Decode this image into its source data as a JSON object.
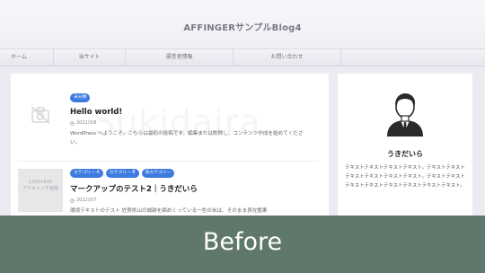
{
  "header": {
    "site_title": "AFFINGERサンプルBlog4"
  },
  "nav": {
    "items": [
      "ホーム",
      "当サイト",
      "運営者情報",
      "お問い合わせ"
    ]
  },
  "watermark": "Sukidaira",
  "posts": [
    {
      "categories": [
        "未分類"
      ],
      "title": "Hello world!",
      "date": "2022/3/8",
      "excerpt": "WordPress へようこそ。こちらは最初の投稿です。編集または削除し、コンテンツ作成を始めてください。",
      "thumbnail": "no-image"
    },
    {
      "categories": [
        "カテゴリー A",
        "カテゴリー B",
        "孫カテゴリー"
      ],
      "title": "マークアップのテスト2｜うきだいら",
      "date": "2022/3/7",
      "excerpt": "環境テキストのテスト 佐賀県山の城跡を締めくっている一色の米は、そのまま表在整果",
      "thumbnail_text": "1200×630\nアイキャッチ画像"
    }
  ],
  "sidebar": {
    "author_name": "うきだいら",
    "author_bio": "テキストテキストテキストテキスト。テキストテキストテキストテキストテキストテキスト。テキストテキストテキストテキストテキストテキストテキストテキスト。"
  },
  "banner": {
    "label": "Before"
  },
  "colors": {
    "accent": "#3d7be0",
    "banner_bg": "#5f786b",
    "page_bg": "#ebebf1"
  }
}
